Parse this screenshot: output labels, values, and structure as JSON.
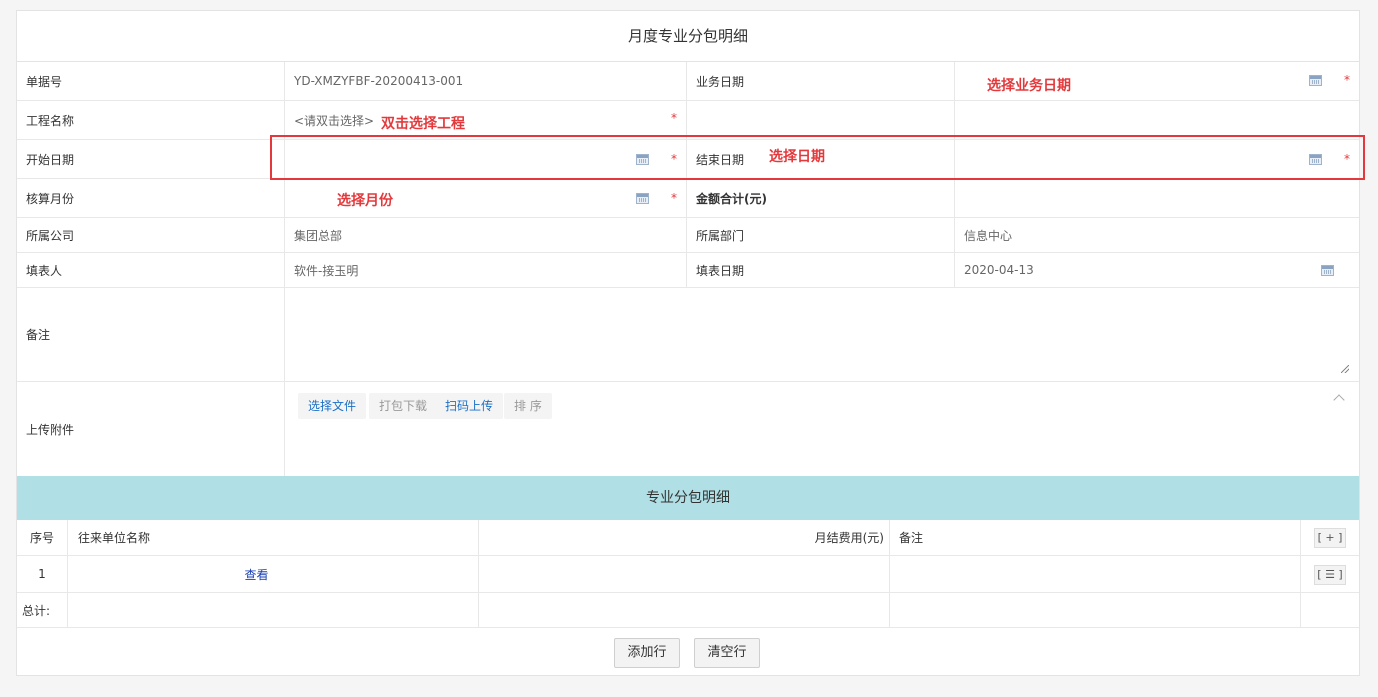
{
  "form": {
    "title": "月度专业分包明细",
    "fields": {
      "doc_no_label": "单据号",
      "doc_no_value": "YD-XMZYFBF-20200413-001",
      "biz_date_label": "业务日期",
      "project_label": "工程名称",
      "project_placeholder": "<请双击选择>",
      "start_date_label": "开始日期",
      "end_date_label": "结束日期",
      "month_label": "核算月份",
      "amount_label": "金额合计(元)",
      "company_label": "所属公司",
      "company_value": "集团总部",
      "dept_label": "所属部门",
      "dept_value": "信息中心",
      "filler_label": "填表人",
      "filler_value": "软件-接玉明",
      "fill_date_label": "填表日期",
      "fill_date_value": "2020-04-13",
      "remark_label": "备注",
      "attach_label": "上传附件",
      "required_mark": "*"
    },
    "attachment_buttons": {
      "select_file": "选择文件",
      "pack_download": "打包下载",
      "scan_upload": "扫码上传",
      "sort": "排 序"
    },
    "annotations": {
      "biz_date": "选择业务日期",
      "project": "双击选择工程",
      "date": "选择日期",
      "month": "选择月份"
    }
  },
  "detail": {
    "title": "专业分包明细",
    "columns": {
      "seq": "序号",
      "unit_name": "往来单位名称",
      "monthly_fee": "月结费用(元)",
      "remark": "备注"
    },
    "add_mini": "[ + ]",
    "menu_mini": "[ ☰ ]",
    "rows": [
      {
        "seq": "1",
        "unit_name_link": "查看"
      }
    ],
    "total_label": "总计:"
  },
  "actions": {
    "add_row": "添加行",
    "clear_rows": "清空行"
  },
  "colors": {
    "accent_red": "#e4393c",
    "header_cyan": "#b0e0e6",
    "link_blue": "#1a6fc6"
  }
}
